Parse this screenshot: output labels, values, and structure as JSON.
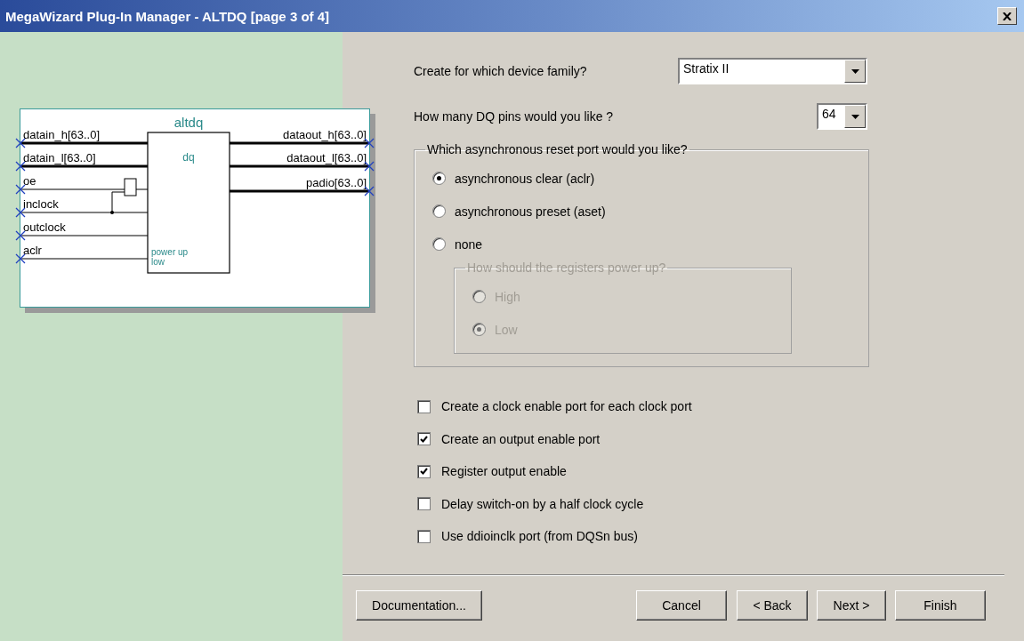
{
  "window": {
    "title": "MegaWizard Plug-In Manager - ALTDQ [page 3 of 4]"
  },
  "diagram": {
    "title": "altdq",
    "block_label": "dq",
    "block_note": [
      "power up",
      "low"
    ],
    "inputs": [
      "datain_h[63..0]",
      "datain_l[63..0]",
      "oe",
      "inclock",
      "outclock",
      "aclr"
    ],
    "outputs": [
      "dataout_h[63..0]",
      "dataout_l[63..0]",
      "padio[63..0]"
    ]
  },
  "device_family": {
    "label": "Create for which device family?",
    "value": "Stratix II"
  },
  "dq_pins": {
    "label": "How many DQ pins would you like ?",
    "value": "64"
  },
  "reset_group": {
    "title": "Which asynchronous reset port would you like?",
    "options": [
      {
        "label": "asynchronous clear (aclr)",
        "selected": true
      },
      {
        "label": "asynchronous preset (aset)",
        "selected": false
      },
      {
        "label": "none",
        "selected": false
      }
    ],
    "power_up": {
      "title": "How should the registers power up?",
      "disabled": true,
      "options": [
        {
          "label": "High",
          "selected": false
        },
        {
          "label": "Low",
          "selected": true
        }
      ]
    }
  },
  "checkboxes": [
    {
      "label": "Create a clock enable port for each clock port",
      "checked": false
    },
    {
      "label": "Create an output enable port",
      "checked": true
    },
    {
      "label": "Register output enable",
      "checked": true
    },
    {
      "label": "Delay switch-on by a half clock cycle",
      "checked": false
    },
    {
      "label": "Use ddioinclk port (from DQSn bus)",
      "checked": false
    }
  ],
  "buttons": [
    {
      "label": "Documentation..."
    },
    {
      "label": "Cancel"
    },
    {
      "label": "< Back"
    },
    {
      "label": "Next >"
    },
    {
      "label": "Finish"
    }
  ]
}
